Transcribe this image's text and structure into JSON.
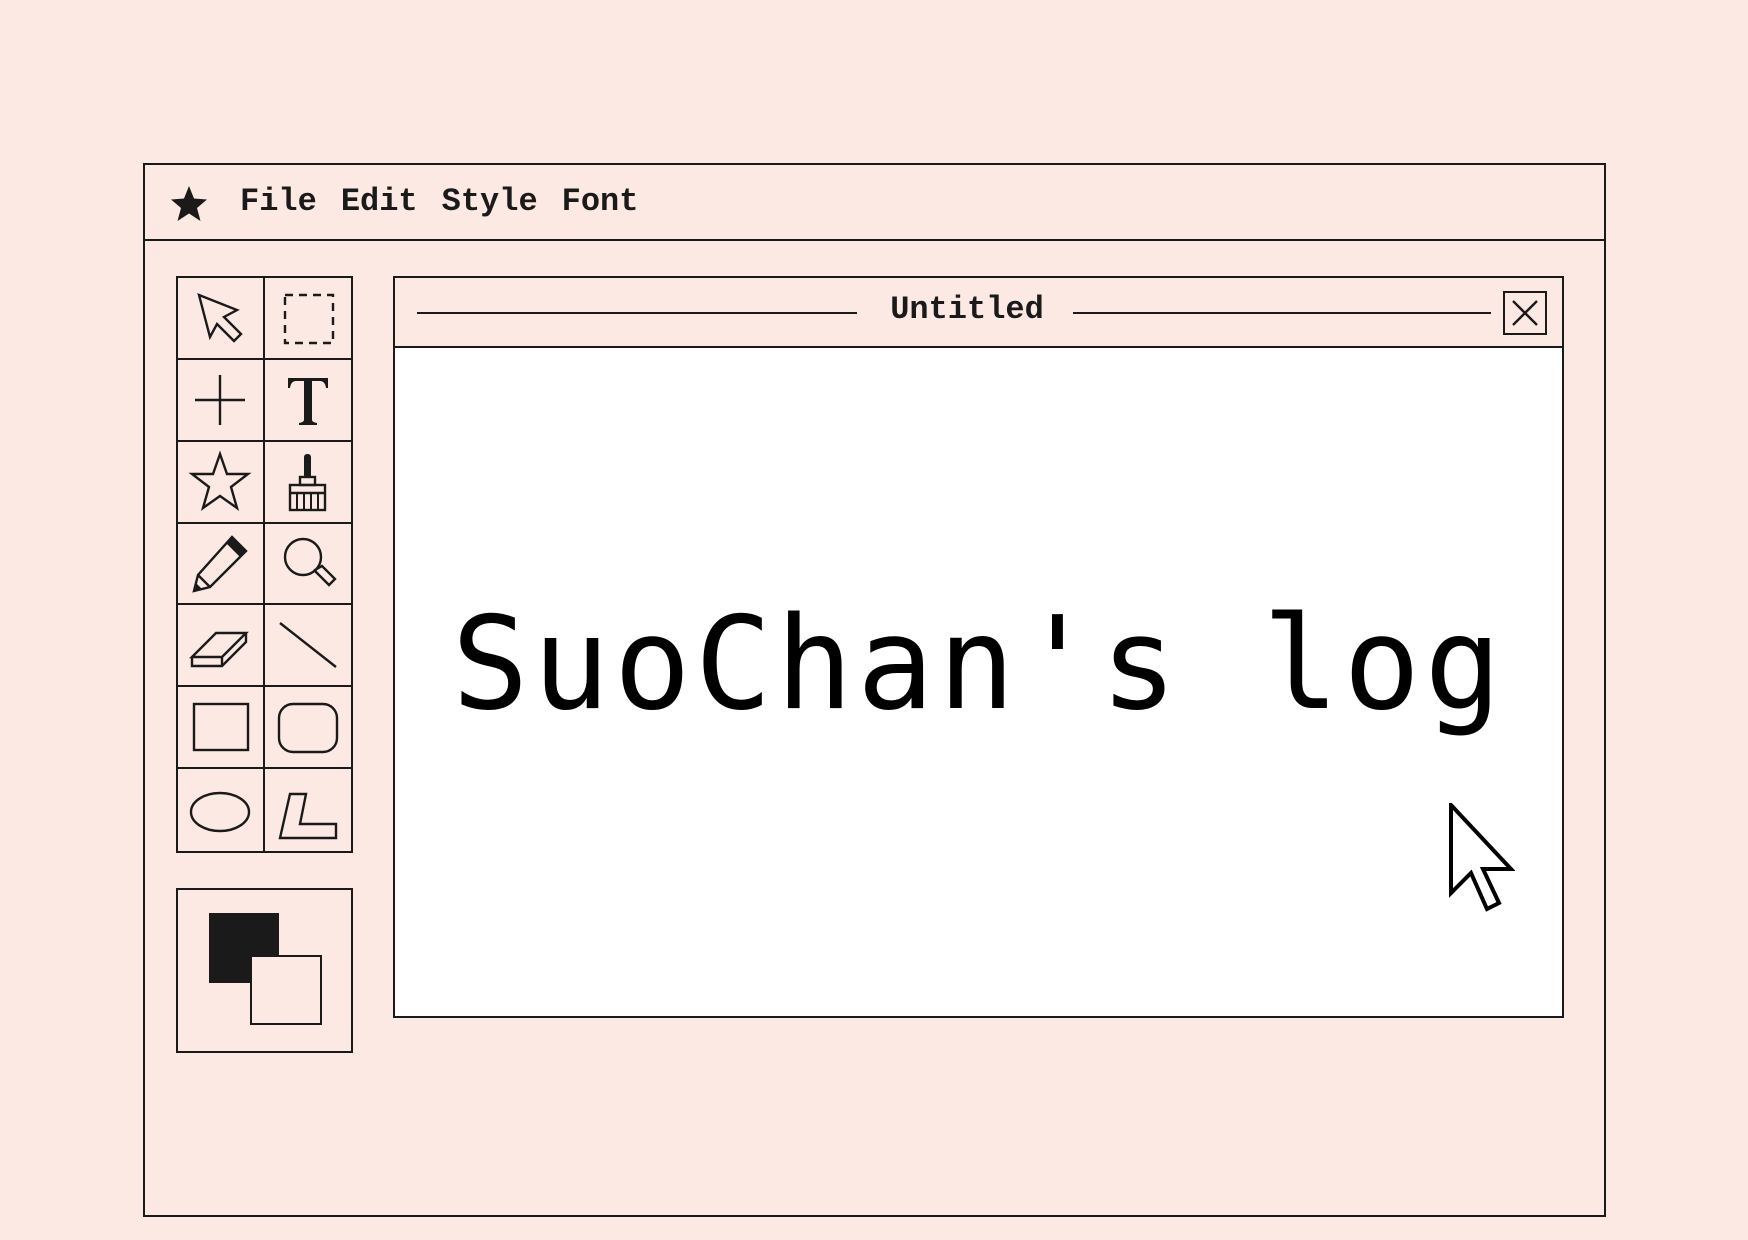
{
  "menubar": {
    "logo_icon": "star-icon",
    "items": [
      "File",
      "Edit",
      "Style",
      "Font"
    ]
  },
  "toolbox": {
    "tools": [
      "arrow-select-icon",
      "marquee-select-icon",
      "crosshair-icon",
      "text-tool-icon",
      "star-shape-icon",
      "paint-brush-icon",
      "pencil-icon",
      "magnifier-icon",
      "eraser-icon",
      "line-tool-icon",
      "rectangle-icon",
      "rounded-rectangle-icon",
      "oval-icon",
      "polygon-icon"
    ]
  },
  "colors": {
    "foreground": "#1a1a1a",
    "background": "#fde9e3",
    "canvas": "#ffffff"
  },
  "document": {
    "title": "Untitled",
    "content": "SuoChan's log",
    "close_icon": "close-icon"
  }
}
